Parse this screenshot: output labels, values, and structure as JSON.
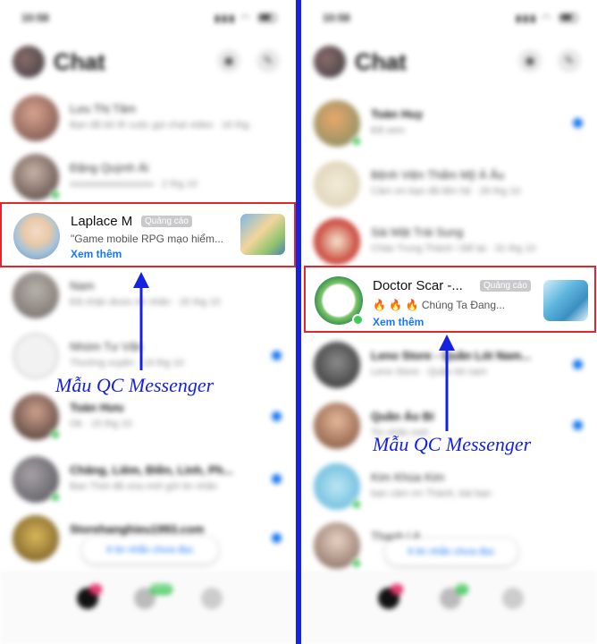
{
  "annotation_color": "#1523e0",
  "highlight_color": "#e3262b",
  "link_color": "#1877f2",
  "left": {
    "status_time": "10:58",
    "header_title": "Chat",
    "header_icons": [
      "camera-icon",
      "compose-icon"
    ],
    "chats_before_ad": [
      {
        "name": "Lưu Thị Tâm",
        "snippet": "Bạn đã bỏ lỡ cuộc gọi chat video · 16 thg 10",
        "online": false,
        "unread": false
      },
      {
        "name": "Đặng Quỳnh Ái",
        "snippet": "xxxxxxxxxxxxxxxxx · 2 thg 10",
        "online": true,
        "unread": false
      }
    ],
    "ad": {
      "name": "Laplace M",
      "badge": "Quảng cáo",
      "text": "\"Game mobile RPG mạo hiểm...",
      "link": "Xem thêm"
    },
    "chats_after_ad": [
      {
        "name": "Nam",
        "snippet": "Đã nhận được tin nhắn · 20 thg 10",
        "online": false,
        "unread": false
      },
      {
        "name": "Nhóm Tư Vấn",
        "snippet": "Thường xuyên · 19 thg 10",
        "online": false,
        "unread": true
      },
      {
        "name": "Toàn Hưu",
        "snippet": "Ok · 15 thg 10",
        "online": true,
        "unread": true
      },
      {
        "name": "Chăng, Liêm, Điền, Linh, Ph...",
        "snippet": "Ban Thời đã vừa mới gửi tin nhắn",
        "online": true,
        "unread": true
      },
      {
        "name": "Storehanghieu1993.com",
        "snippet": "",
        "online": false,
        "unread": true
      }
    ],
    "unread_pill": "6 tin nhắn chưa đọc",
    "tab_badge_1": "1",
    "tab_badge_2": "NEW",
    "annotation": "Mẫu QC Messenger"
  },
  "right": {
    "status_time": "10:58",
    "header_title": "Chat",
    "header_icons": [
      "camera-icon",
      "compose-icon"
    ],
    "chats_before_ad": [
      {
        "name": "Toàn Huy",
        "snippet": "Đã xem",
        "online": true,
        "unread": true
      },
      {
        "name": "Bệnh Viện Thẩm Mỹ Á Âu",
        "snippet": "Cảm ơn bạn đã liên hệ · 26 thg 10",
        "online": false,
        "unread": false
      },
      {
        "name": "Sài Mật Trái Sung",
        "snippet": "Chào Trung Thành ! Để lại · 31 thg 10",
        "online": false,
        "unread": false
      }
    ],
    "ad": {
      "name": "Doctor Scar -...",
      "badge": "Quảng cáo",
      "text": "🔥 🔥 🔥  Chúng Ta Đang...",
      "link": "Xem thêm"
    },
    "chats_after_ad": [
      {
        "name": "Leno Store - Quần Lót Nam...",
        "snippet": "Leno Store · Quần lót nam",
        "online": false,
        "unread": true
      },
      {
        "name": "Quần Áo Bí",
        "snippet": "Tin nhắn mới",
        "online": false,
        "unread": true
      },
      {
        "name": "Kim Khùa Kim",
        "snippet": "bạn cảm ơn Thành, bài bạn",
        "online": true,
        "unread": false
      },
      {
        "name": "Thanh Lê",
        "snippet": "",
        "online": true,
        "unread": false
      }
    ],
    "unread_pill": "6 tin nhắn chưa đọc",
    "tab_badge_1": "1",
    "tab_badge_2": "5",
    "annotation": "Mẫu QC Messenger"
  }
}
